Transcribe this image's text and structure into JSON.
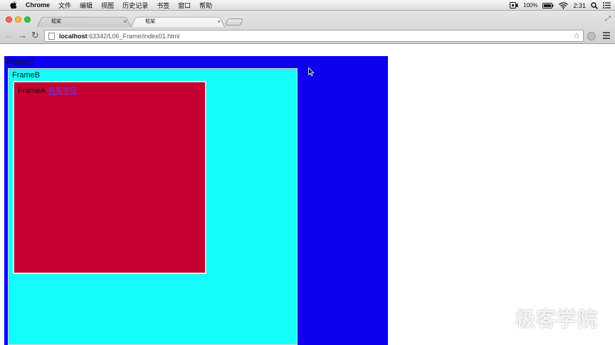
{
  "menubar": {
    "app_name": "Chrome",
    "items": [
      "文件",
      "编辑",
      "视图",
      "历史记录",
      "书签",
      "窗口",
      "帮助"
    ],
    "battery": "100%",
    "clock": "2:31"
  },
  "tabs": [
    {
      "title": "框架",
      "close": "×"
    },
    {
      "title": "框架",
      "close": "×"
    }
  ],
  "address": {
    "host": "localhost",
    "path": ":63342/L06_Frame/index01.html"
  },
  "frames": {
    "c_label": "FrameC",
    "b_label": "FrameB",
    "a_label": "FrameA",
    "a_link": "极客学院"
  },
  "watermark": "极客学院",
  "colors": {
    "frame_c": "#0c00ee",
    "frame_b": "#14fdfd",
    "frame_a": "#c50032",
    "link": "#5a3cff"
  }
}
